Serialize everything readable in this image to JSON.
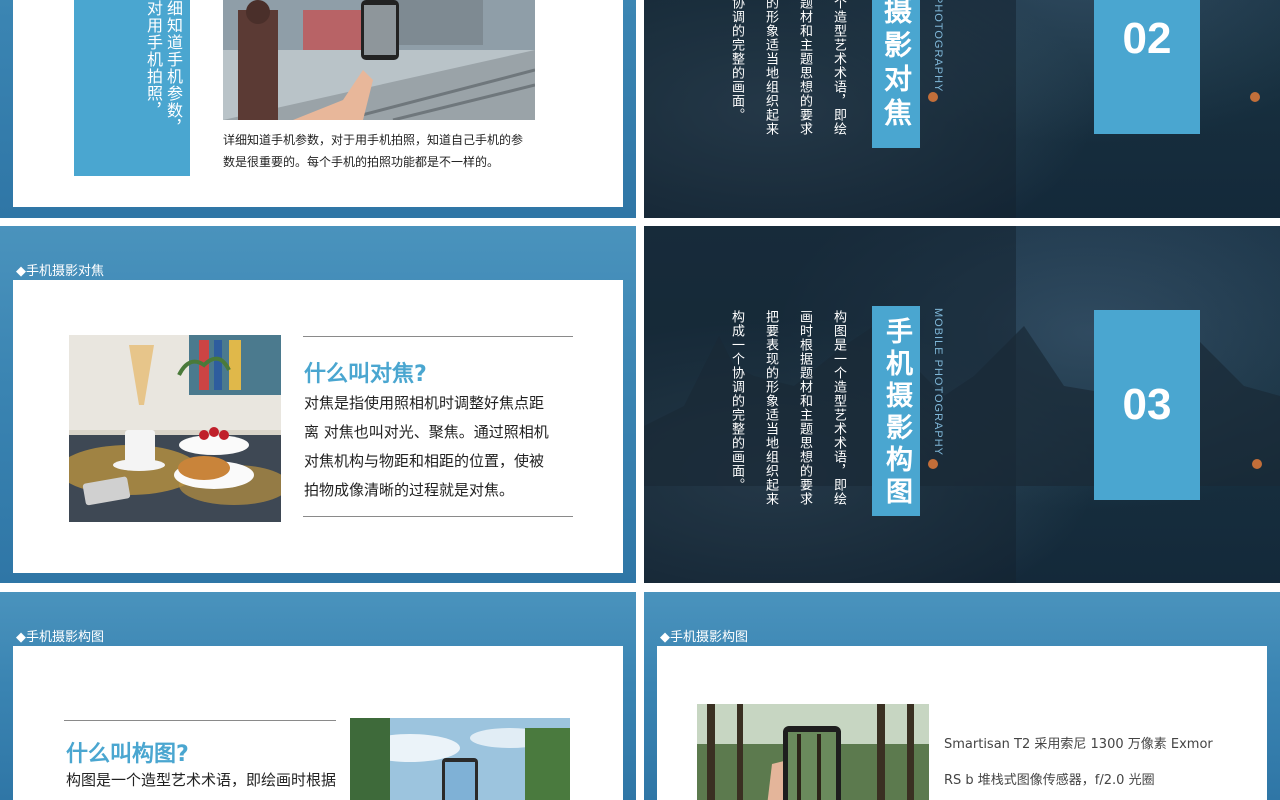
{
  "slides": {
    "s1": {
      "side_vertical_text": "细知道手机参数，对用手机拍照，",
      "caption_line1": "详细知道手机参数，对于用手机拍照，知道自己手机的参",
      "caption_line2": "数是很重要的。每个手机的拍照功能都是不一样的。"
    },
    "s2": {
      "vert_col1": "个造型艺术术语，即绘",
      "vert_col2": "题材和主题思想的要求",
      "vert_col3": "的形象适当地组织起来",
      "vert_col4": "协调的完整的画面。",
      "title": "摄影对焦",
      "english": "PHOTOGRAPHY",
      "number": "02"
    },
    "s3": {
      "tag": "◆手机摄影对焦",
      "heading": "什么叫对焦?",
      "para_line1": "对焦是指使用照相机时调整好焦点距",
      "para_line2": "离 对焦也叫对光、聚焦。通过照相机",
      "para_line3": "对焦机构与物距和相距的位置，使被",
      "para_line4": "拍物成像清晰的过程就是对焦。"
    },
    "s4": {
      "vert_col1": "构图是一个造型艺术术语，即绘",
      "vert_col2": "画时根据题材和主题思想的要求",
      "vert_col3": "把要表现的形象适当地组织起来",
      "vert_col4": "构成一个协调的完整的画面。",
      "title": "手机摄影构图",
      "english": "MOBILE PHOTOGRAPHY",
      "number": "03"
    },
    "s5": {
      "tag": "◆手机摄影构图",
      "heading": "什么叫构图?",
      "para_line1": "构图是一个造型艺术术语，即绘画时根据"
    },
    "s6": {
      "tag": "◆手机摄影构图",
      "spec_line1": "Smartisan T2 采用索尼 1300 万像素 Exmor",
      "spec_line2": "RS b 堆栈式图像传感器，f/2.0 光圈"
    }
  },
  "colors": {
    "accent_blue": "#4aa6d0",
    "slide_bg_blue": "#3a84b2",
    "night_bg": "#17303f"
  }
}
